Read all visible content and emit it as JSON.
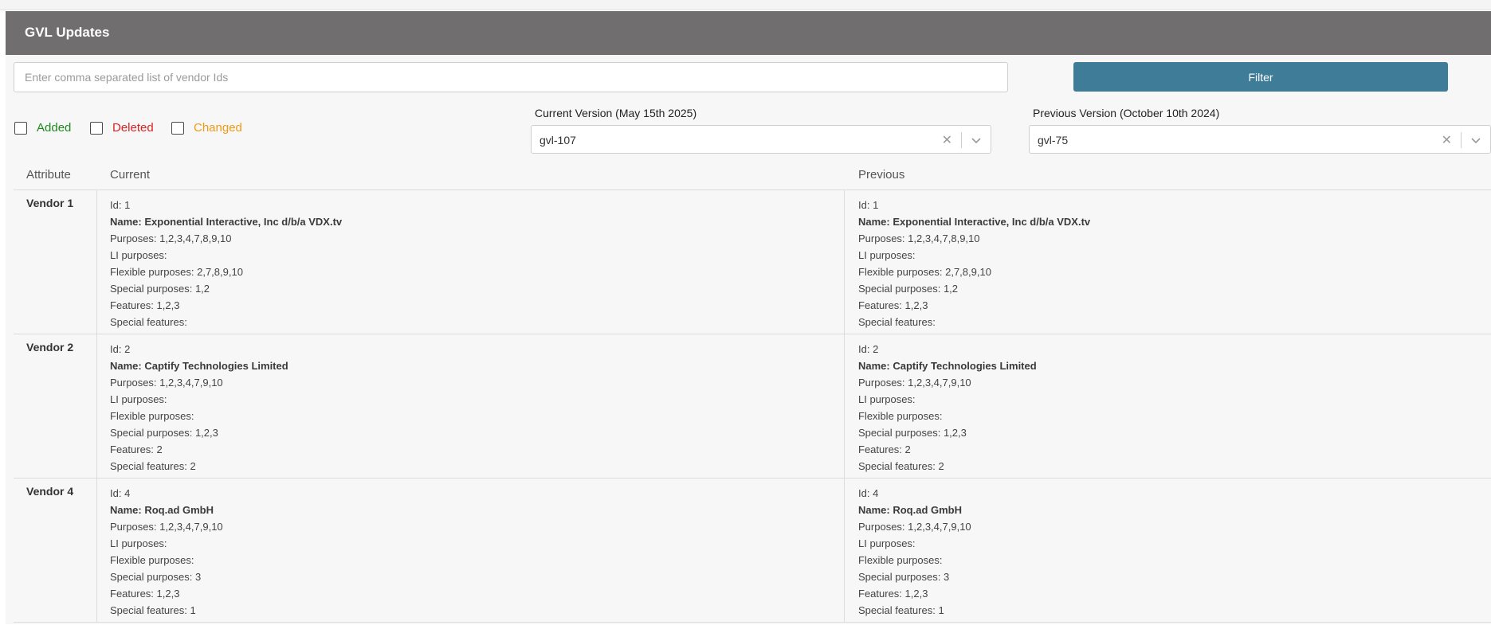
{
  "header": {
    "title": "GVL Updates"
  },
  "search": {
    "placeholder": "Enter comma separated list of vendor Ids",
    "value": ""
  },
  "filter": {
    "label": "Filter",
    "color": "#3f7c98"
  },
  "checkboxes": [
    {
      "label": "Added",
      "color": "#1e8a1e",
      "checked": false
    },
    {
      "label": "Deleted",
      "color": "#e02020",
      "checked": false
    },
    {
      "label": "Changed",
      "color": "#f09a14",
      "checked": false
    }
  ],
  "current_version": {
    "label": "Current Version (May 15th 2025)",
    "value": "gvl-107"
  },
  "previous_version": {
    "label": "Previous Version (October 10th 2024)",
    "value": "gvl-75"
  },
  "icons": {
    "clear": "clear-x-icon",
    "dropdown": "chevron-down-icon"
  },
  "columns": {
    "attribute": "Attribute",
    "current": "Current",
    "previous": "Previous"
  },
  "rows": [
    {
      "attribute": "Vendor 1",
      "current": [
        "Id: 1",
        "Name: Exponential Interactive, Inc d/b/a VDX.tv",
        "Purposes: 1,2,3,4,7,8,9,10",
        "LI purposes:",
        "Flexible purposes: 2,7,8,9,10",
        "Special purposes: 1,2",
        "Features: 1,2,3",
        "Special features:"
      ],
      "previous": [
        "Id: 1",
        "Name: Exponential Interactive, Inc d/b/a VDX.tv",
        "Purposes: 1,2,3,4,7,8,9,10",
        "LI purposes:",
        "Flexible purposes: 2,7,8,9,10",
        "Special purposes: 1,2",
        "Features: 1,2,3",
        "Special features:"
      ]
    },
    {
      "attribute": "Vendor 2",
      "current": [
        "Id: 2",
        "Name: Captify Technologies Limited",
        "Purposes: 1,2,3,4,7,9,10",
        "LI purposes:",
        "Flexible purposes:",
        "Special purposes: 1,2,3",
        "Features: 2",
        "Special features: 2"
      ],
      "previous": [
        "Id: 2",
        "Name: Captify Technologies Limited",
        "Purposes: 1,2,3,4,7,9,10",
        "LI purposes:",
        "Flexible purposes:",
        "Special purposes: 1,2,3",
        "Features: 2",
        "Special features: 2"
      ]
    },
    {
      "attribute": "Vendor 4",
      "current": [
        "Id: 4",
        "Name: Roq.ad GmbH",
        "Purposes: 1,2,3,4,7,9,10",
        "LI purposes:",
        "Flexible purposes:",
        "Special purposes: 3",
        "Features: 1,2,3",
        "Special features: 1"
      ],
      "previous": [
        "Id: 4",
        "Name: Roq.ad GmbH",
        "Purposes: 1,2,3,4,7,9,10",
        "LI purposes:",
        "Flexible purposes:",
        "Special purposes: 3",
        "Features: 1,2,3",
        "Special features: 1"
      ]
    }
  ]
}
